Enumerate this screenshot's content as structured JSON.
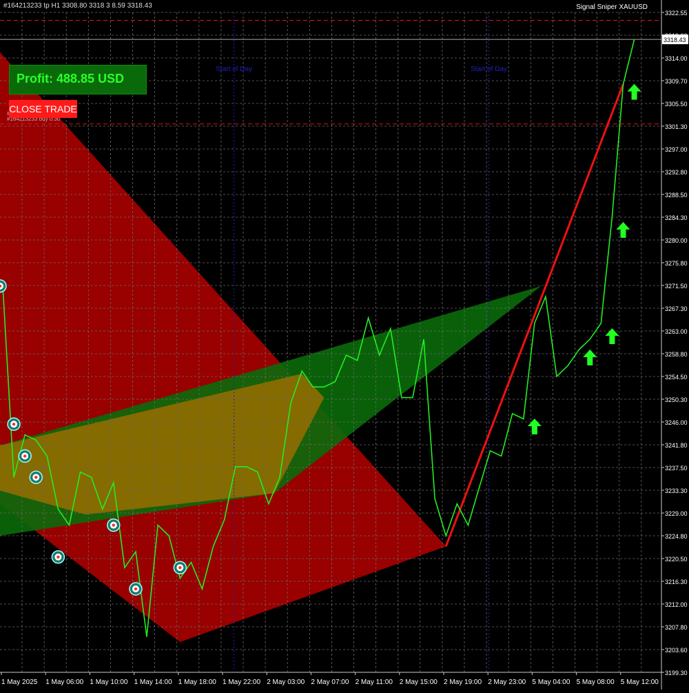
{
  "header": {
    "order_label": "#164213233 tp",
    "ohlc_text": "H1  3308.80 3318  3  8.59 3318.43",
    "symbol_title": "Signal Sniper XAUUSD"
  },
  "panel": {
    "profit_text": "Profit: 488.85 USD",
    "close_button_label": "CLOSE TRADE",
    "order_tag_upper": "#",
    "order_tag_lower": "#164213233 buy 0.30"
  },
  "session_labels": [
    "Start of Day",
    "Start of Day"
  ],
  "price_label": "3318.43",
  "colors": {
    "background": "#000000",
    "grid": "#6b6b6b",
    "price_line": "#22ee22",
    "trend_line": "#ee1111",
    "red_zone": "#990000",
    "green_zone": "#0a6a0a",
    "arrow": "#22ff22",
    "panel_bg": "#0a6a0a",
    "panel_text": "#2aff2a",
    "button_bg": "#ff1a1a",
    "session_label": "#2020c0"
  },
  "chart_data": {
    "type": "line",
    "symbol": "XAUUSD",
    "timeframe": "H1",
    "ylim": [
      3199.3,
      3323.5
    ],
    "y_ticks": [
      "3322.55",
      "3318.00",
      "3314.00",
      "3309.70",
      "3305.50",
      "3301.30",
      "3297.00",
      "3292.80",
      "3288.50",
      "3284.30",
      "3280.00",
      "3275.80",
      "3271.50",
      "3267.30",
      "3263.00",
      "3258.80",
      "3254.50",
      "3250.30",
      "3246.00",
      "3241.80",
      "3237.50",
      "3233.30",
      "3229.00",
      "3224.80",
      "3220.50",
      "3216.30",
      "3212.00",
      "3207.80",
      "3203.60",
      "3199.30"
    ],
    "x_ticks": [
      "1 May 2025",
      "1 May 06:00",
      "1 May 10:00",
      "1 May 14:00",
      "1 May 18:00",
      "1 May 22:00",
      "2 May 03:00",
      "2 May 07:00",
      "2 May 11:00",
      "2 May 15:00",
      "2 May 19:00",
      "2 May 23:00",
      "5 May 04:00",
      "5 May 08:00",
      "5 May 12:00"
    ],
    "series": [
      {
        "values": [
          3272,
          3236,
          3244,
          3243,
          3240,
          3230,
          3227,
          3237,
          3236,
          3230,
          3235,
          3219,
          3222,
          3206,
          3227,
          3225,
          3217,
          3220,
          3215,
          3223,
          3228,
          3238,
          3238,
          3237,
          3231,
          3236,
          3250,
          3256,
          3253,
          3253,
          3254,
          3259,
          3258,
          3266,
          3259,
          3264,
          3251,
          3251,
          3262,
          3232,
          3225,
          3231,
          3227,
          3234,
          3241,
          3240,
          3248,
          3247,
          3265,
          3270,
          3255,
          3257,
          3260,
          3262,
          3265,
          3285,
          3310,
          3318.43
        ]
      }
    ],
    "current_price": 3318.43,
    "horizontal_levels": [
      {
        "price": 3322.0,
        "style": "dashed",
        "color": "#ee1111"
      },
      {
        "price": 3318.43,
        "style": "solid",
        "color": "#aaaaaa"
      },
      {
        "price": 3302.5,
        "style": "dashed",
        "color": "#ee1111"
      }
    ],
    "trend_line": {
      "from_bar": 40,
      "to_bar": 56,
      "from_price": 3223,
      "to_price": 3310
    },
    "signal_markers_buy": [
      {
        "bar": 48,
        "price": 3245.5
      },
      {
        "bar": 53,
        "price": 3258.5
      },
      {
        "bar": 55,
        "price": 3262.5
      },
      {
        "bar": 56,
        "price": 3282.5
      },
      {
        "bar": 57,
        "price": 3308.5
      }
    ],
    "trade_markers": [
      {
        "bar": 0,
        "price": 3272
      },
      {
        "bar": 1,
        "price": 3246
      },
      {
        "bar": 2,
        "price": 3240
      },
      {
        "bar": 3,
        "price": 3236
      },
      {
        "bar": 5,
        "price": 3221
      },
      {
        "bar": 10,
        "price": 3227
      },
      {
        "bar": 12,
        "price": 3215
      },
      {
        "bar": 16,
        "price": 3219
      }
    ]
  }
}
